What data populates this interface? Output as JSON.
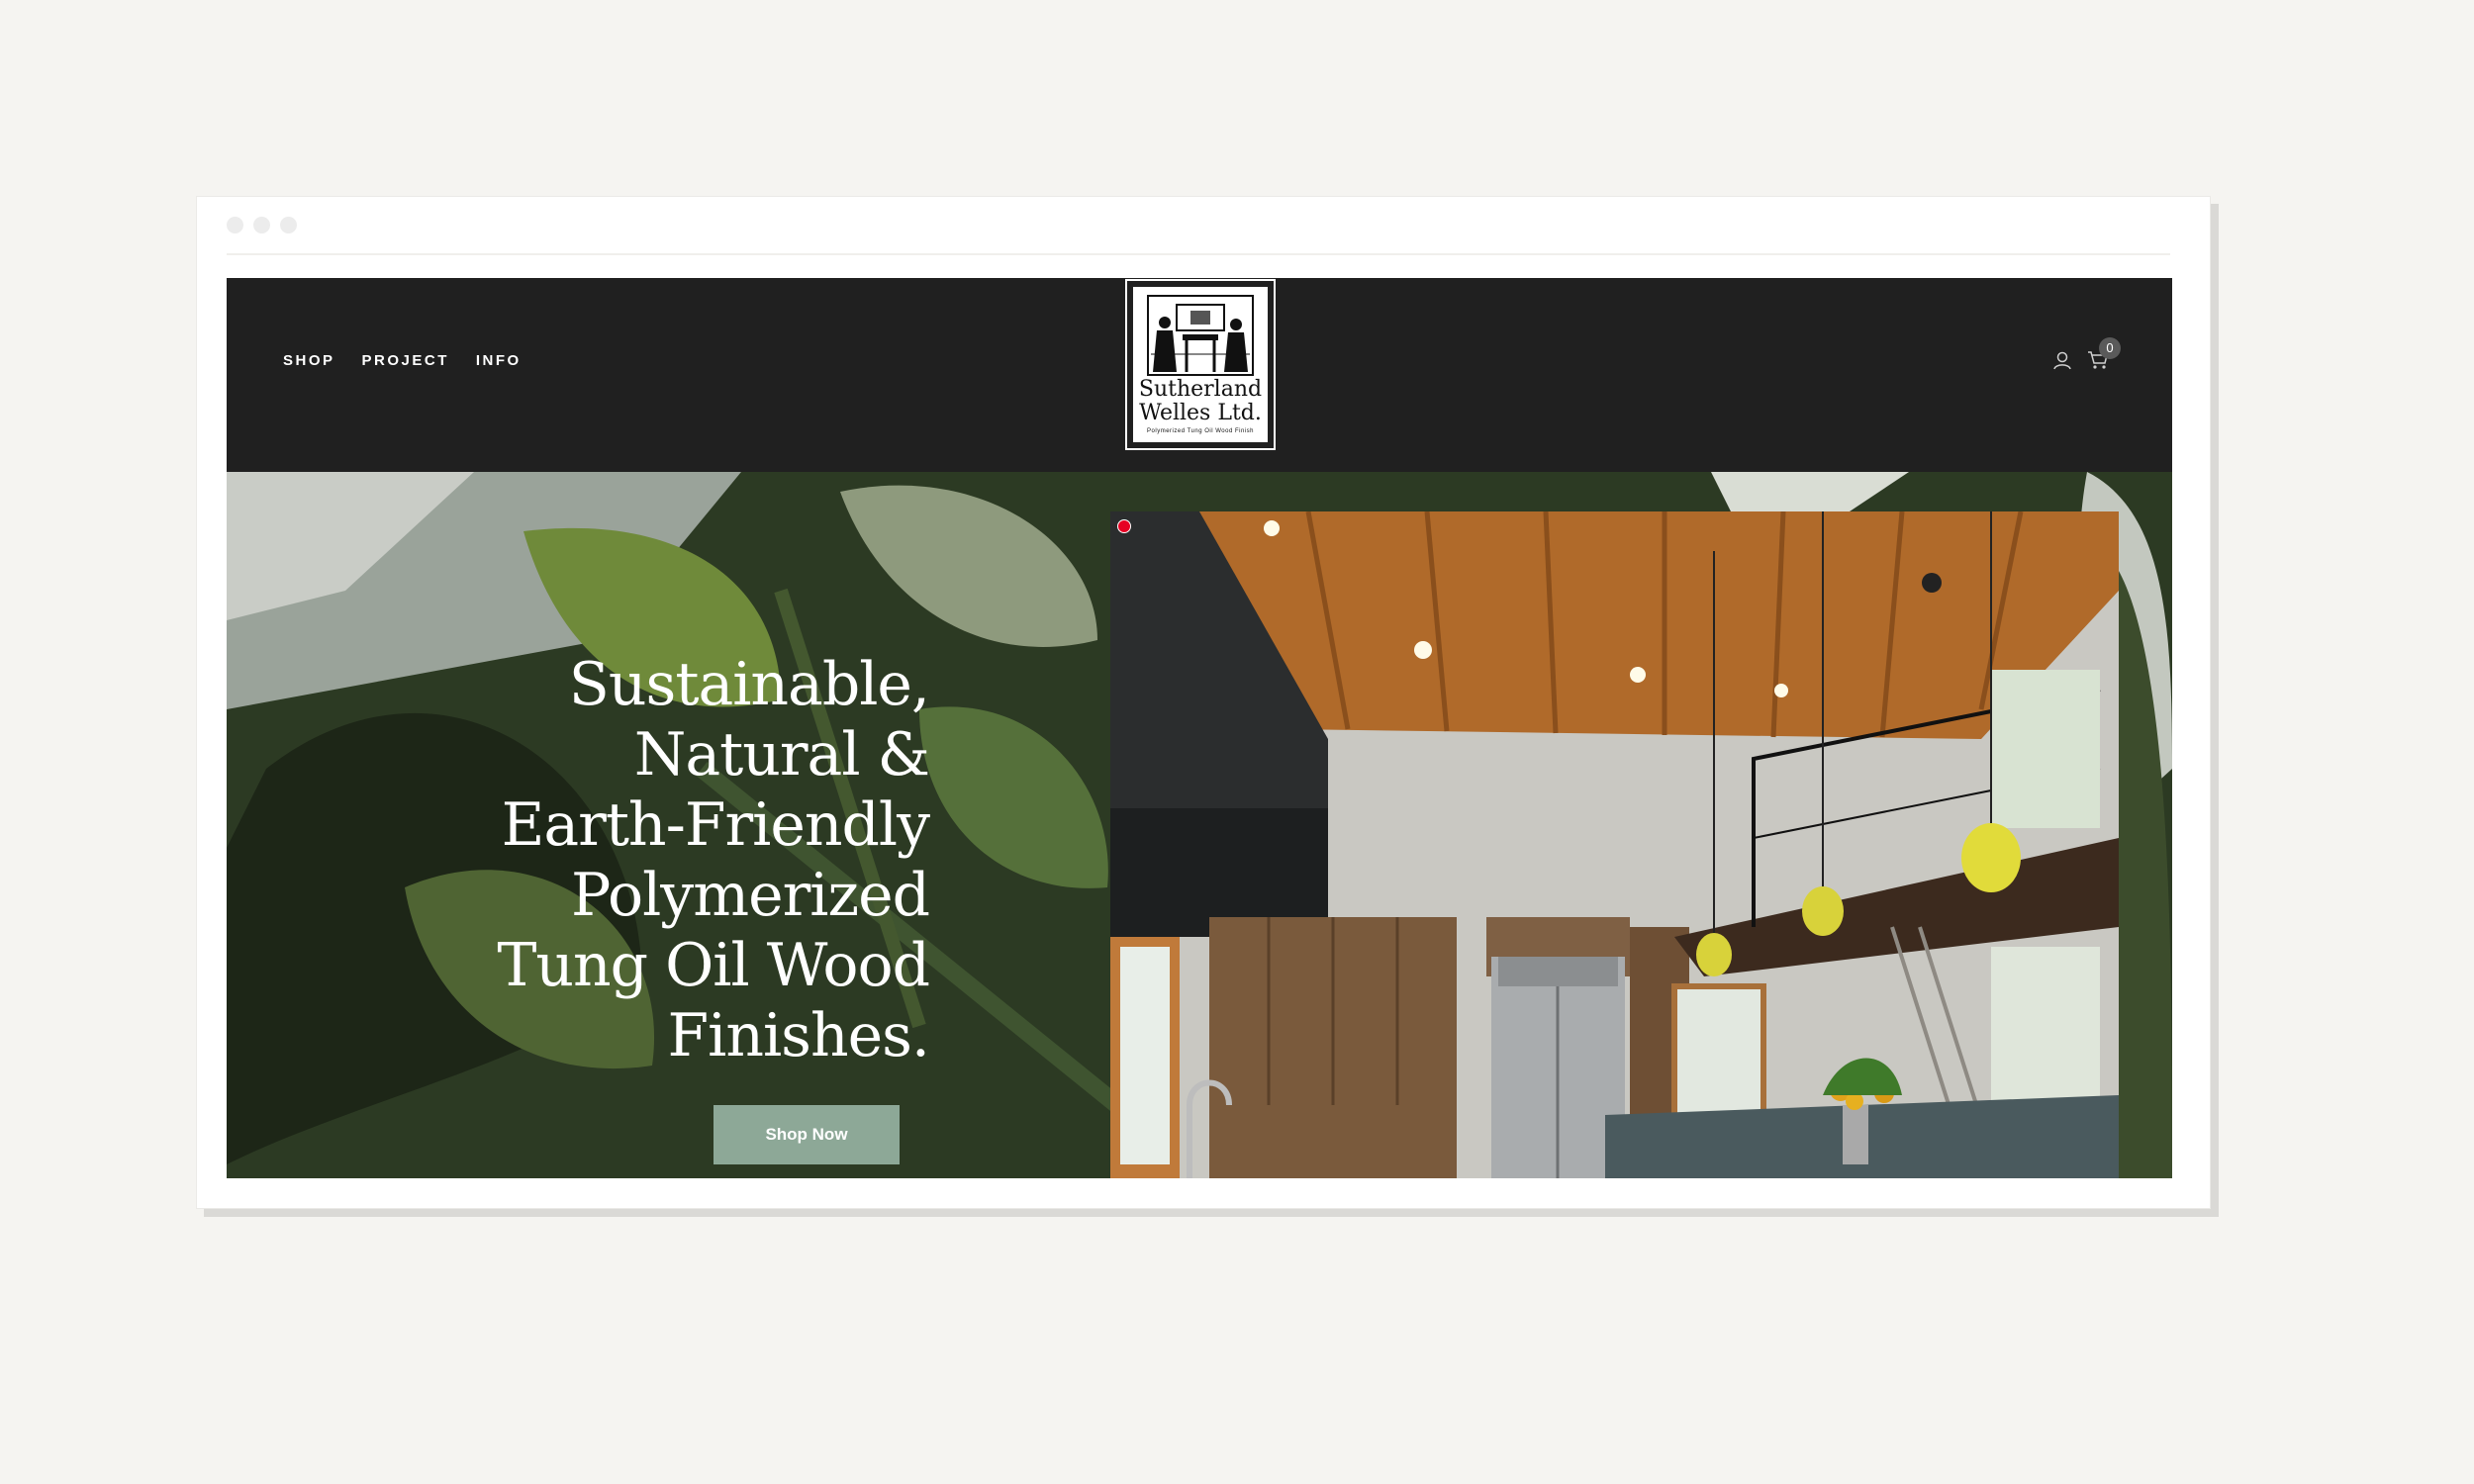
{
  "nav": {
    "items": [
      "SHOP",
      "PROJECT",
      "INFO"
    ]
  },
  "logo": {
    "name_line1": "Sutherland",
    "name_line2": "Welles Ltd.",
    "tagline": "Polymerized Tung Oil Wood Finish"
  },
  "cart": {
    "count": "0"
  },
  "hero": {
    "headline_lines": [
      "Sustainable,",
      "Natural &",
      "Earth-Friendly",
      "Polymerized",
      "Tung Oil Wood",
      "Finishes."
    ],
    "cta_label": "Shop Now"
  },
  "icons": {
    "account": "user-icon",
    "cart": "cart-icon",
    "pin": "pinterest-icon"
  },
  "colors": {
    "header_bg": "#202020",
    "cta_bg": "#8da897",
    "page_bg": "#f5f4f1"
  }
}
